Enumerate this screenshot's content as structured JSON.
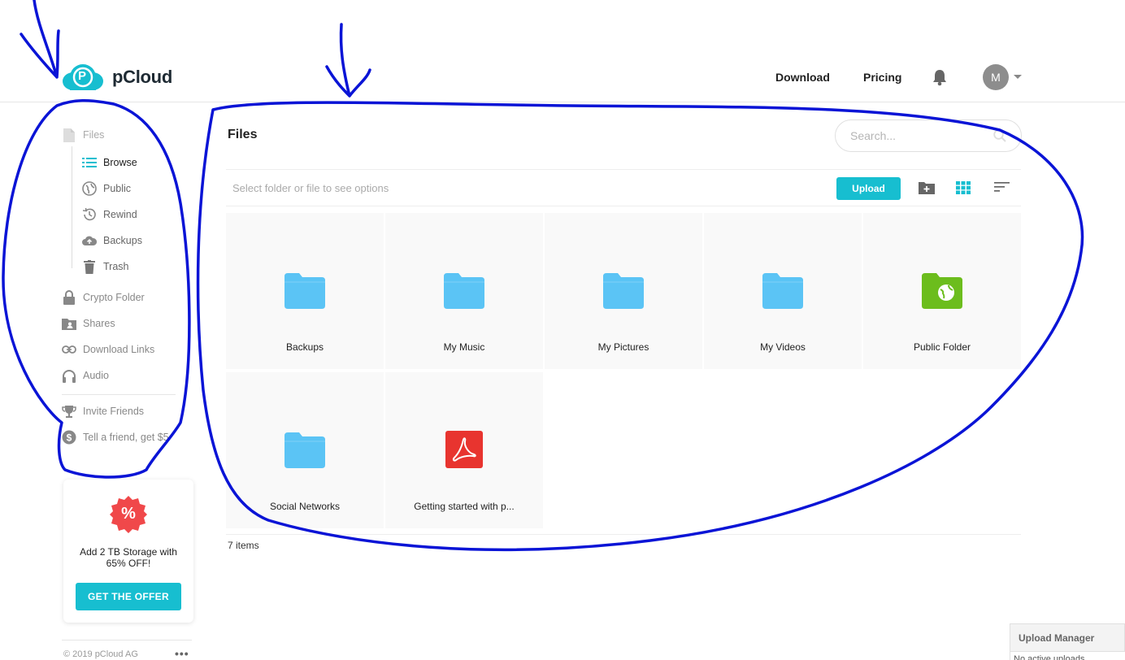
{
  "header": {
    "brand": "pCloud",
    "logo_letter": "P",
    "nav": [
      {
        "label": "Download"
      },
      {
        "label": "Pricing"
      }
    ],
    "notifications_icon": "bell-icon",
    "avatar_initial": "M"
  },
  "sidebar": {
    "files": {
      "label": "Files",
      "icon": "file-icon"
    },
    "sub_items": [
      {
        "label": "Browse",
        "icon": "list-icon",
        "active": true
      },
      {
        "label": "Public",
        "icon": "globe-icon"
      },
      {
        "label": "Rewind",
        "icon": "history-icon"
      },
      {
        "label": "Backups",
        "icon": "cloud-upload-icon"
      },
      {
        "label": "Trash",
        "icon": "trash-icon"
      }
    ],
    "items": [
      {
        "label": "Crypto Folder",
        "icon": "lock-icon"
      },
      {
        "label": "Shares",
        "icon": "shared-folder-icon"
      },
      {
        "label": "Download Links",
        "icon": "link-icon"
      },
      {
        "label": "Audio",
        "icon": "headphones-icon"
      }
    ],
    "extra": [
      {
        "label": "Invite Friends",
        "icon": "trophy-icon"
      },
      {
        "label": "Tell a friend, get $5",
        "icon": "dollar-icon"
      }
    ],
    "promo": {
      "badge": "%",
      "text": "Add 2 TB Storage with 65% OFF!",
      "button": "GET THE OFFER"
    },
    "footer": {
      "copyright": "© 2019 pCloud AG",
      "more": "•••"
    }
  },
  "main": {
    "title": "Files",
    "search": {
      "placeholder": "Search...",
      "value": ""
    },
    "toolbar": {
      "hint": "Select folder or file to see options",
      "upload": "Upload"
    },
    "files": [
      {
        "name": "Backups",
        "type": "folder"
      },
      {
        "name": "My Music",
        "type": "folder"
      },
      {
        "name": "My Pictures",
        "type": "folder"
      },
      {
        "name": "My Videos",
        "type": "folder"
      },
      {
        "name": "Public Folder",
        "type": "public-folder"
      },
      {
        "name": "Social Networks",
        "type": "folder"
      },
      {
        "name": "Getting started with p...",
        "type": "pdf"
      }
    ],
    "items_count": "7 items"
  },
  "upload_manager": {
    "title": "Upload Manager",
    "status": "No active uploads"
  },
  "colors": {
    "accent": "#17bed0",
    "folder": "#5bc4f5",
    "public_folder": "#6cbd1d",
    "pdf": "#e8342f",
    "annotation": "#0a14d6"
  }
}
